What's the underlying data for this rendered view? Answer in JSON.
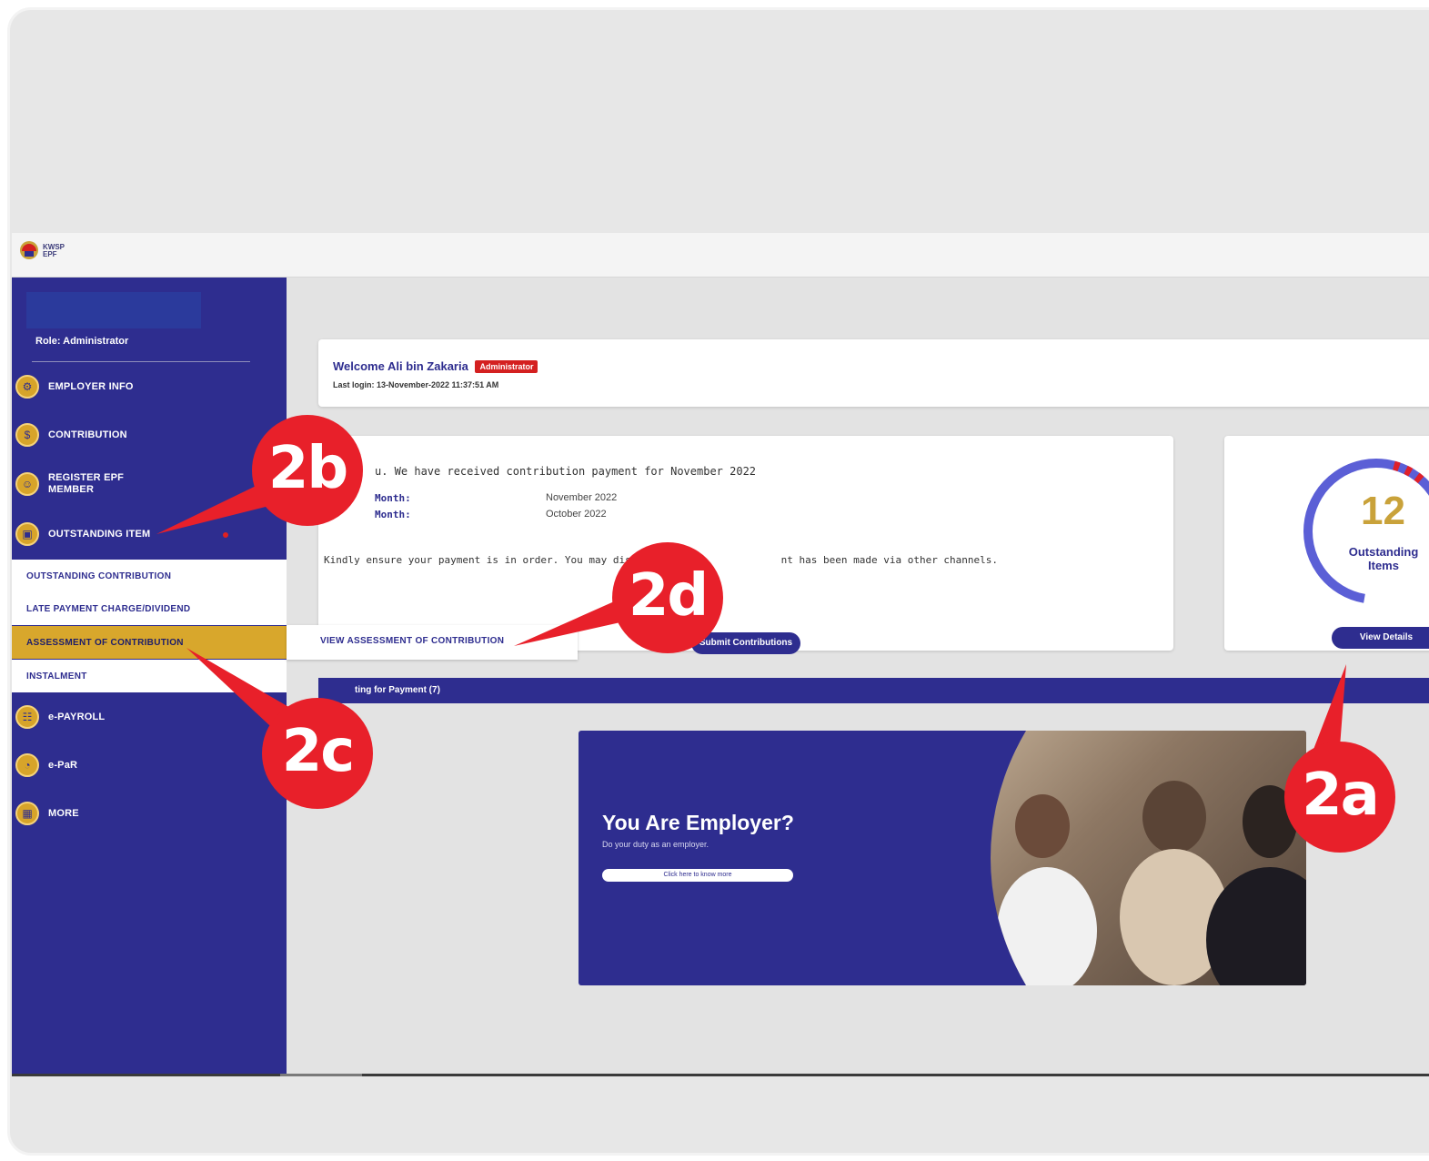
{
  "brand": {
    "logo_text_line1": "KWSP",
    "logo_text_line2": "EPF"
  },
  "sidebar": {
    "role": "Role: Administrator",
    "items": [
      {
        "label": "EMPLOYER INFO",
        "icon": "gear-icon"
      },
      {
        "label": "CONTRIBUTION",
        "icon": "dollar-icon"
      },
      {
        "label": "REGISTER EPF MEMBER",
        "icon": "user-add-icon"
      },
      {
        "label": "OUTSTANDING ITEM",
        "icon": "folder-icon"
      }
    ],
    "submenu": [
      {
        "label": "OUTSTANDING CONTRIBUTION"
      },
      {
        "label": "LATE PAYMENT CHARGE/DIVIDEND"
      },
      {
        "label": "ASSESSMENT OF CONTRIBUTION"
      },
      {
        "label": "INSTALMENT"
      }
    ],
    "items2": [
      {
        "label": "e-PAYROLL",
        "icon": "payroll-icon"
      },
      {
        "label": "e-PaR",
        "icon": "clock-icon"
      },
      {
        "label": "MORE",
        "icon": "grid-icon"
      }
    ]
  },
  "welcome": {
    "text": "Welcome  Ali bin Zakaria",
    "badge": "Administrator",
    "last_login": "Last login: 13-November-2022 11:37:51 AM"
  },
  "contribution": {
    "message": "u. We have received contribution payment for November 2022",
    "label1": "Month:",
    "value1": "November 2022",
    "label2": "Month:",
    "value2": "October 2022",
    "note": "Kindly ensure your payment is in order. You may disre",
    "note_tail": "nt has been made via other channels.",
    "submit_label": "Submit Contributions"
  },
  "outstanding": {
    "count": "12",
    "label": "Outstanding Items",
    "button": "View Details",
    "colors": {
      "ring": "#5b5fd6",
      "accent": "#e0202a"
    }
  },
  "popout": {
    "label": "VIEW ASSESSMENT OF CONTRIBUTION"
  },
  "waiting": {
    "label": "ting for Payment (7)"
  },
  "banner": {
    "title": "You Are Employer?",
    "subtitle": "Do your duty as an employer.",
    "button": "Click here to know more"
  },
  "callouts": {
    "a": "2a",
    "b": "2b",
    "c": "2c",
    "d": "2d"
  },
  "colors": {
    "primary": "#2e2d8f",
    "gold": "#d8a72c",
    "callout": "#e8202a"
  }
}
